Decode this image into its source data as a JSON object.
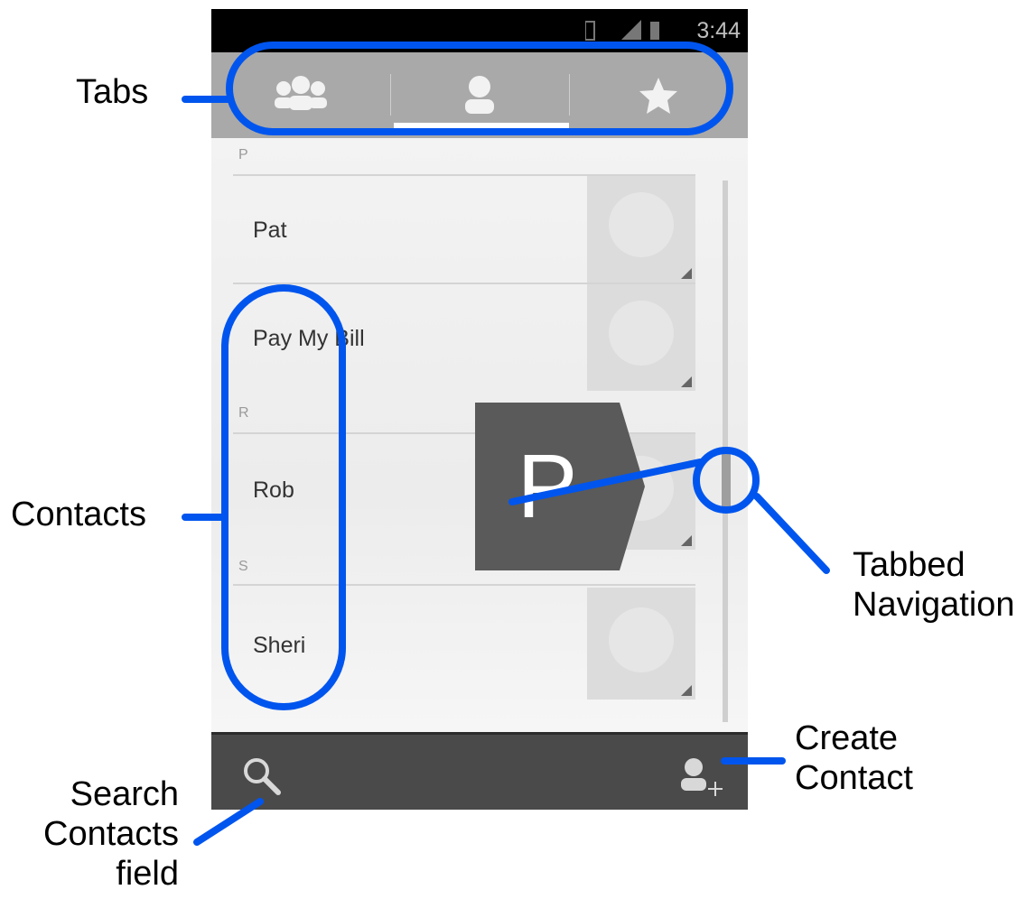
{
  "status_bar": {
    "time": "3:44"
  },
  "tabs": [
    {
      "icon": "groups-icon",
      "selected": false
    },
    {
      "icon": "person-icon",
      "selected": true
    },
    {
      "icon": "star-icon",
      "selected": false
    }
  ],
  "contacts": {
    "sections": [
      {
        "letter": "P",
        "items": [
          "Pat",
          "Pay My Bill"
        ]
      },
      {
        "letter": "R",
        "items": [
          "Rob"
        ]
      },
      {
        "letter": "S",
        "items": [
          "Sheri"
        ]
      }
    ]
  },
  "fast_scroll": {
    "letter": "P"
  },
  "bottom_bar": {
    "left_icon": "search-icon",
    "right_icon": "add-contact-icon"
  },
  "annotations": {
    "tabs": "Tabs",
    "contacts": "Contacts",
    "tabbed_navigation": [
      "Tabbed",
      "Navigation"
    ],
    "create_contact": [
      "Create",
      "Contact"
    ],
    "search_contacts": [
      "Search",
      "Contacts",
      "field"
    ]
  },
  "colors": {
    "annotation_blue": "#0055ee",
    "tab_bar": "#a9a9a9",
    "bottom_bar": "#4a4a4a"
  }
}
